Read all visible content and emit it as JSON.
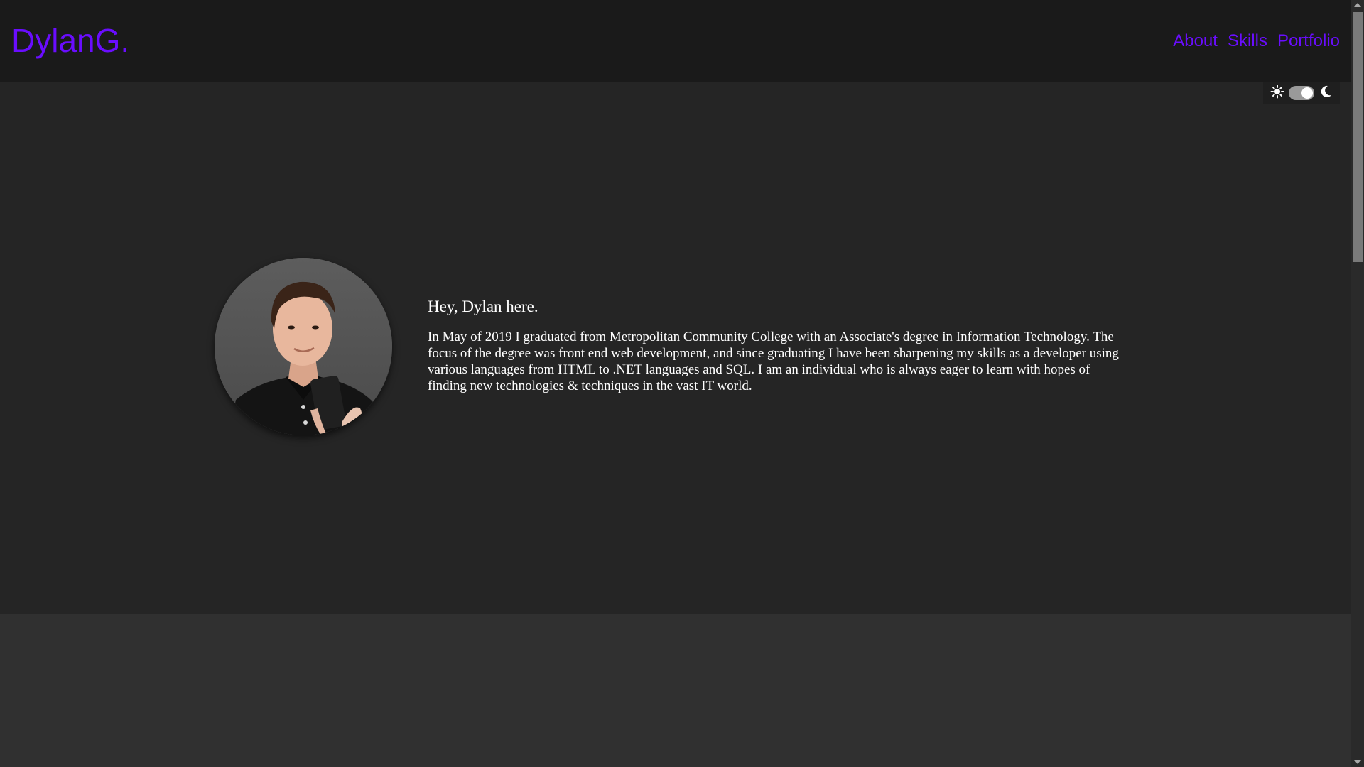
{
  "nav": {
    "brand": "DylanG.",
    "links": [
      "About",
      "Skills",
      "Portfolio"
    ]
  },
  "theme_toggle": {
    "light_icon": "sun-icon",
    "dark_icon": "moon-icon",
    "state": "dark"
  },
  "about": {
    "heading": "Hey, Dylan here.",
    "body": "In May of 2019 I graduated from Metropolitan Community College with an Associate's degree in Information Technology. The focus of the degree was front end web development, and since graduating I have been sharpening my skills as a developer using various languages from HTML to .NET languages and SQL. I am an individual who is always eager to learn with hopes of finding new technologies & techniques in the vast IT world."
  },
  "colors": {
    "accent": "#6a0dff",
    "navbar_bg": "#1a1a1a",
    "page_bg": "#252525",
    "section_bg": "#303030"
  }
}
